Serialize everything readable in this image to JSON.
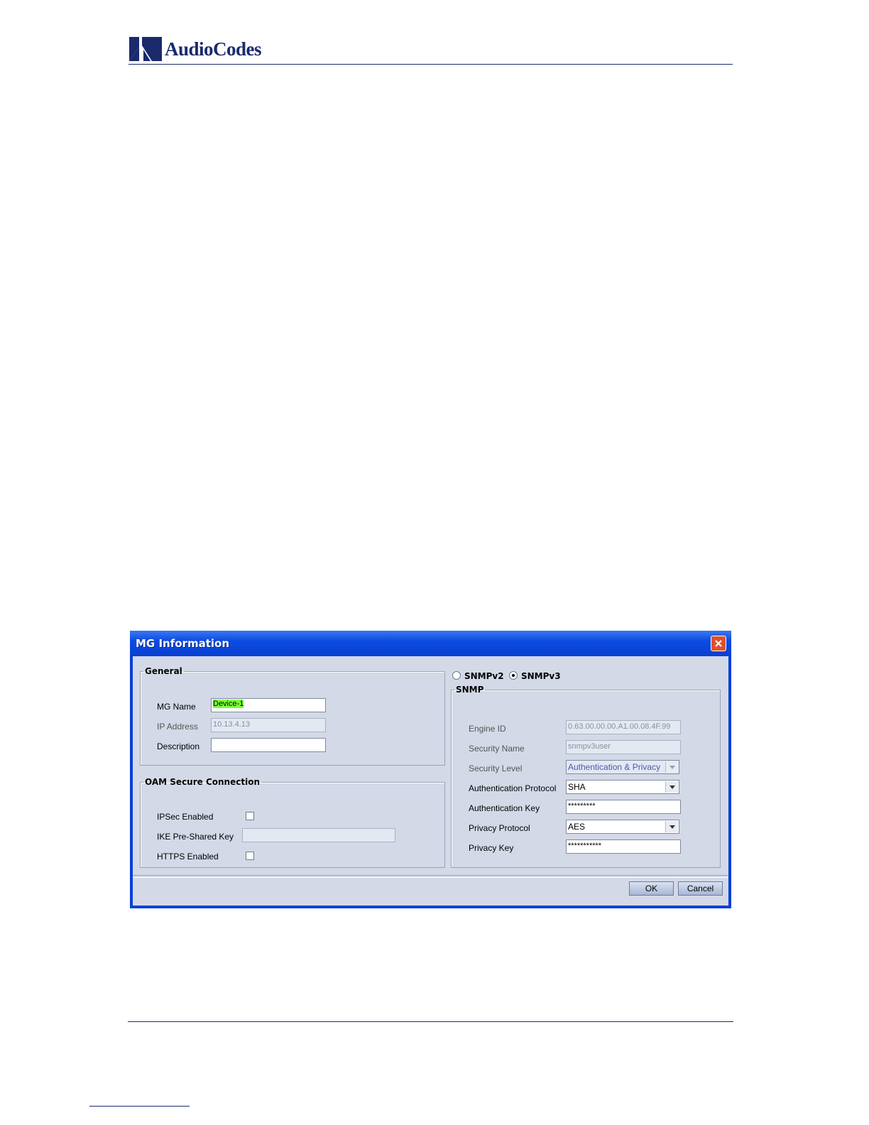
{
  "header": {
    "logo_text": "AudioCodes",
    "brand_color": "#1a2a6c"
  },
  "dialog": {
    "title": "MG Information",
    "close_icon": "close-icon",
    "general": {
      "legend": "General",
      "mg_name_label": "MG Name",
      "mg_name_value": "Device-1",
      "ip_label": "IP Address",
      "ip_value": "10.13.4.13",
      "description_label": "Description",
      "description_value": ""
    },
    "oam": {
      "legend": "OAM Secure Connection",
      "ipsec_label": "IPSec Enabled",
      "ipsec_checked": false,
      "ike_label": "IKE Pre-Shared Key",
      "ike_value": "",
      "https_label": "HTTPS Enabled",
      "https_checked": false
    },
    "snmp_version": {
      "v2_label": "SNMPv2",
      "v3_label": "SNMPv3",
      "selected": "SNMPv3"
    },
    "snmp": {
      "legend": "SNMP",
      "engine_id_label": "Engine ID",
      "engine_id_value": "0.63.00.00.00.A1.00.08.4F.99",
      "security_name_label": "Security Name",
      "security_name_value": "snmpv3user",
      "security_level_label": "Security Level",
      "security_level_value": "Authentication & Privacy",
      "auth_protocol_label": "Authentication Protocol",
      "auth_protocol_value": "SHA",
      "auth_key_label": "Authentication Key",
      "auth_key_value": "*********",
      "privacy_protocol_label": "Privacy Protocol",
      "privacy_protocol_value": "AES",
      "privacy_key_label": "Privacy Key",
      "privacy_key_value": "***********"
    },
    "buttons": {
      "ok": "OK",
      "cancel": "Cancel"
    }
  }
}
